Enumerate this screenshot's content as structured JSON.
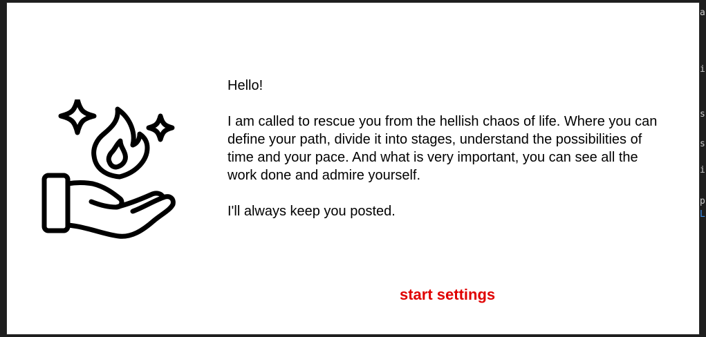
{
  "dialog": {
    "greeting": "Hello!",
    "body": "I am called to rescue you from the hellish chaos of life. Where you can define your path, divide it into stages, understand the possibilities of time and your pace. And what is very important, you can see all the work done and admire yourself.",
    "closing": "I'll always keep you posted.",
    "illustration_icon": "hand-holding-fire-icon",
    "start_button_label": "start settings",
    "accent_color": "#e00000"
  },
  "background_editor": {
    "edge_chars": [
      "a",
      "i",
      "s",
      "s",
      "i",
      "p",
      "L"
    ]
  }
}
